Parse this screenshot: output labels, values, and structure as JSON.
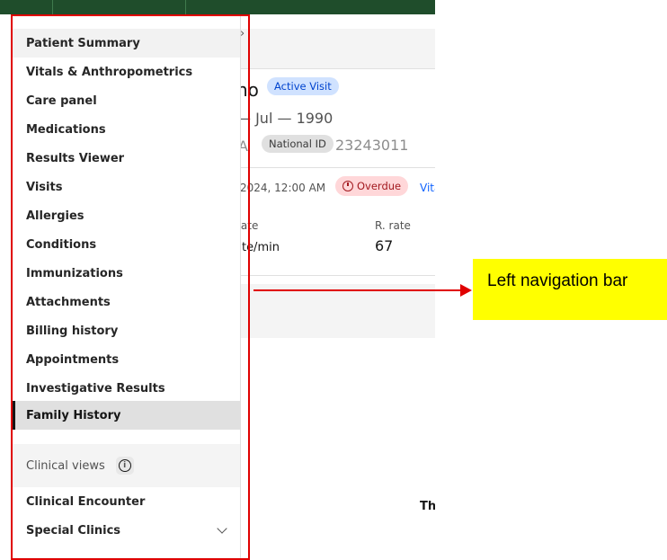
{
  "nav": {
    "items": [
      "Patient Summary",
      "Vitals & Anthropometrics",
      "Care panel",
      "Medications",
      "Results Viewer",
      "Visits",
      "Allergies",
      "Conditions",
      "Immunizations",
      "Attachments",
      "Billing history",
      "Appointments",
      "Investigative Results",
      "Family History"
    ],
    "selected_item": "Family History",
    "section_label": "Clinical views",
    "info_icon": "info-icon",
    "section_items": [
      "Clinical Encounter",
      "Special Clinics"
    ],
    "expand_icon": "chevron-down-icon"
  },
  "patient": {
    "name_fragment": "no",
    "active_badge": "Active Visit",
    "dob_fragment": "— Jul — 1990",
    "sex_fragment": "A",
    "national_id_label": "National ID",
    "national_id_value": "23243011"
  },
  "vitals": {
    "date_fragment": "2024, 12:00 AM",
    "status_badge": "Overdue",
    "link_fragment": "Vita",
    "rate_label_fragment": "rate",
    "rate_value_fragment": "ate/min",
    "r_rate_label": "R. rate",
    "r_rate_value": "67"
  },
  "main_fragment": "Th",
  "annotation": {
    "callout_text": "Left navigation bar",
    "highlight_color": "#e00000",
    "callout_color": "#ffff00"
  },
  "colors": {
    "topbar": "#1f4d2b",
    "active_badge_bg": "#d0e2ff",
    "overdue_bg": "#ffd7d9"
  }
}
